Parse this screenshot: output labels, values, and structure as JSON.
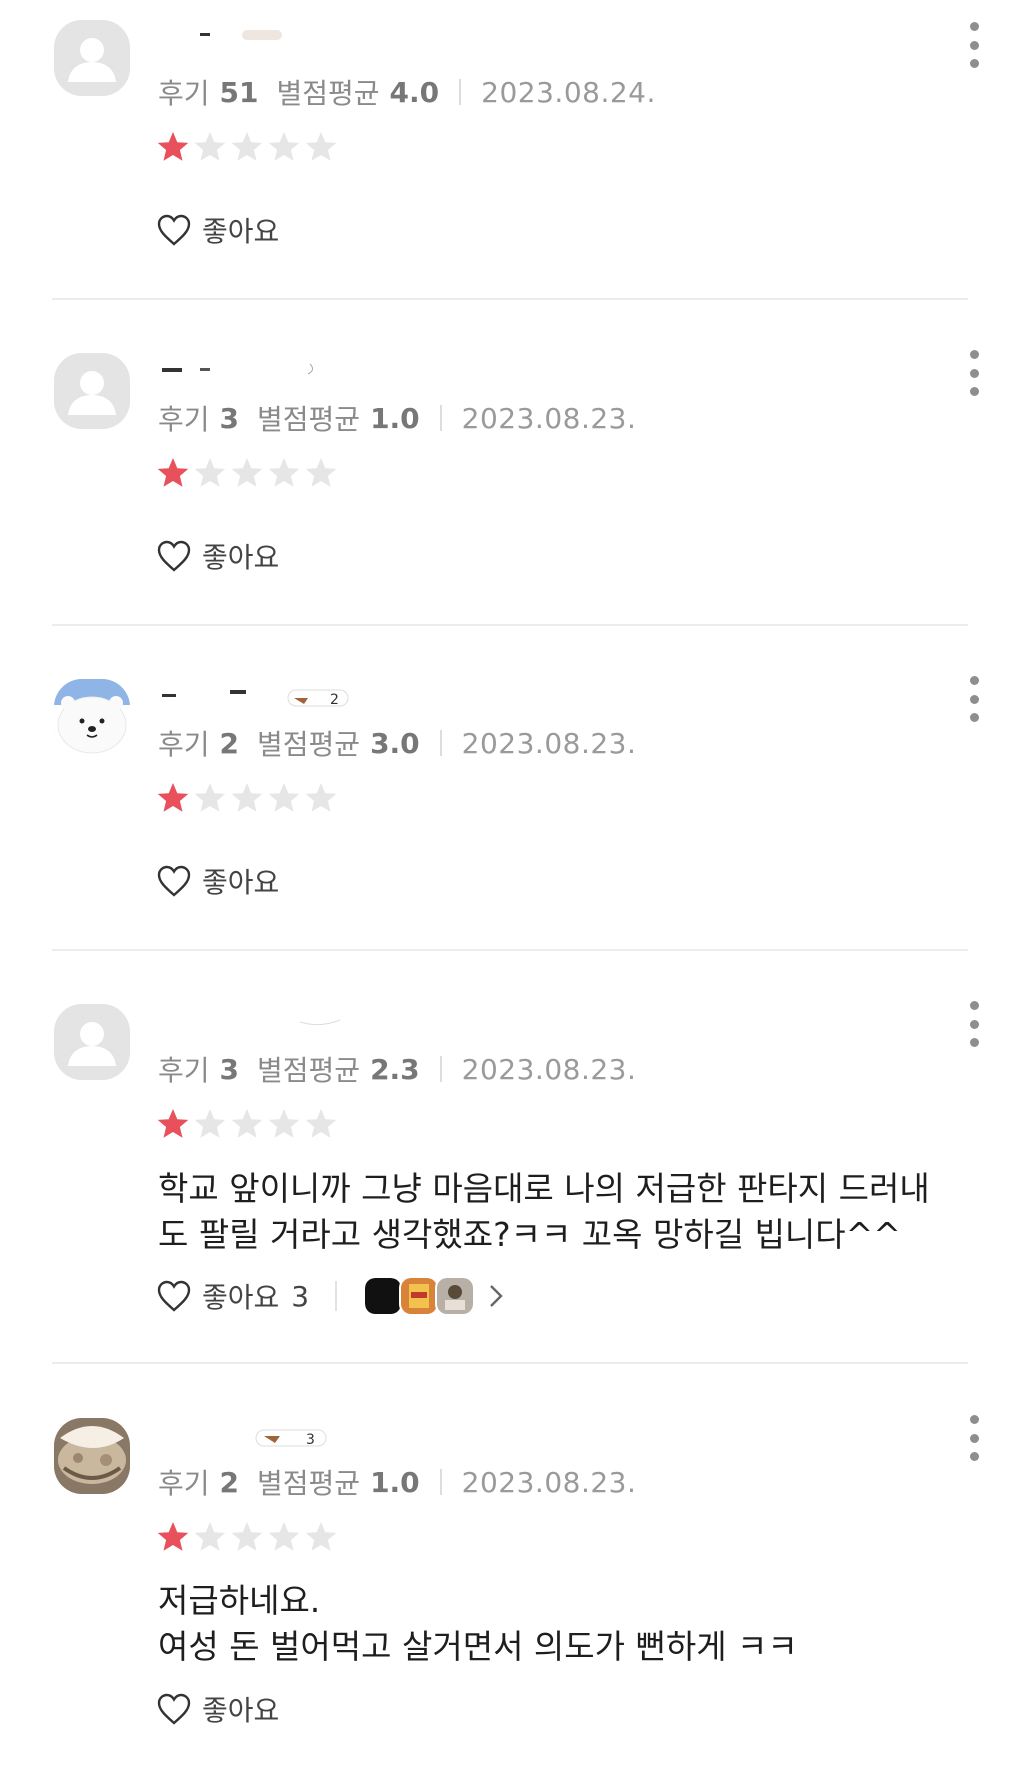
{
  "labels": {
    "review_count": "후기",
    "rating_avg": "별점평균",
    "like": "좋아요"
  },
  "colors": {
    "star_on": "#e8505b",
    "star_off": "#e6e6e6",
    "divider": "#ececec"
  },
  "reviews": [
    {
      "avatar": "default-avatar-icon",
      "review_count": "51",
      "rating_avg": "4.0",
      "date": "2023.08.24.",
      "stars": 1,
      "text_lines": [],
      "like_count": ""
    },
    {
      "avatar": "default-avatar-icon",
      "review_count": "3",
      "rating_avg": "1.0",
      "date": "2023.08.23.",
      "stars": 1,
      "text_lines": [],
      "like_count": ""
    },
    {
      "avatar": "polar-bear-avatar",
      "review_count": "2",
      "rating_avg": "3.0",
      "date": "2023.08.23.",
      "stars": 1,
      "text_lines": [],
      "like_count": ""
    },
    {
      "avatar": "default-avatar-icon",
      "review_count": "3",
      "rating_avg": "2.3",
      "date": "2023.08.23.",
      "stars": 1,
      "text_lines": [
        "학교 앞이니까 그냥 마음대로 나의 저급한 판타지 드러내",
        "도 팔릴 거라고 생각했죠?ㅋㅋ 꼬옥 망하길 빕니다^^"
      ],
      "like_count": "3"
    },
    {
      "avatar": "photo-avatar",
      "review_count": "2",
      "rating_avg": "1.0",
      "date": "2023.08.23.",
      "stars": 1,
      "text_lines": [
        "저급하네요.",
        "여성 돈 벌어먹고 살거면서 의도가 뻔하게 ㅋㅋ"
      ],
      "like_count": ""
    }
  ]
}
